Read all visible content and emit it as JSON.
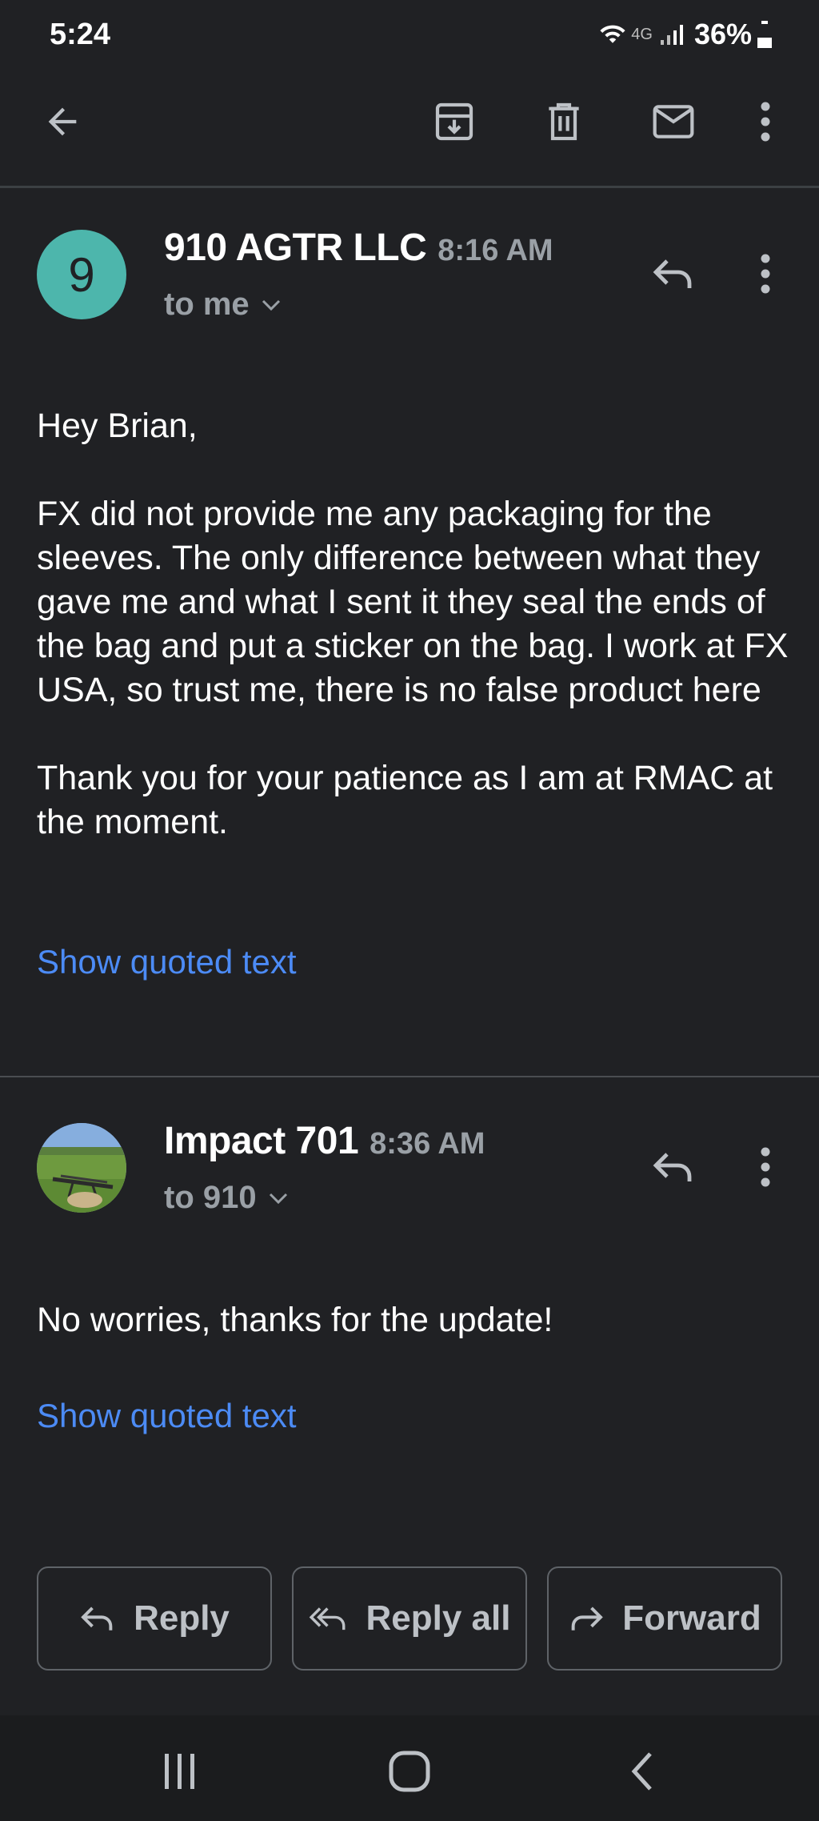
{
  "status_bar": {
    "time": "5:24",
    "network": "4G",
    "battery": "36%"
  },
  "toolbar": {
    "icons": [
      "back-arrow-icon",
      "archive-icon",
      "delete-icon",
      "mark-unread-icon",
      "more-vert-icon"
    ]
  },
  "messages": [
    {
      "avatar_letter": "9",
      "avatar_color": "#4db6ac",
      "sender": "910 AGTR LLC",
      "time": "8:16 AM",
      "recipient": "to me",
      "body": [
        "Hey Brian,",
        "FX did not provide me any packaging for the sleeves. The only difference between what they gave me and what I sent it they seal the ends of the bag and put a sticker on the bag. I work at FX USA, so trust me, there is no false product here",
        "Thank you for your patience as I am at RMAC at the moment."
      ],
      "show_quoted": "Show quoted text"
    },
    {
      "avatar_letter": "",
      "sender": "Impact 701",
      "time": "8:36 AM",
      "recipient": "to 910",
      "body": [
        "No worries, thanks for the update!"
      ],
      "show_quoted": "Show quoted text"
    }
  ],
  "actions": {
    "reply": "Reply",
    "reply_all": "Reply all",
    "forward": "Forward"
  },
  "colors": {
    "background": "#202124",
    "link": "#4c8bf5",
    "accent_avatar": "#4db6ac"
  }
}
